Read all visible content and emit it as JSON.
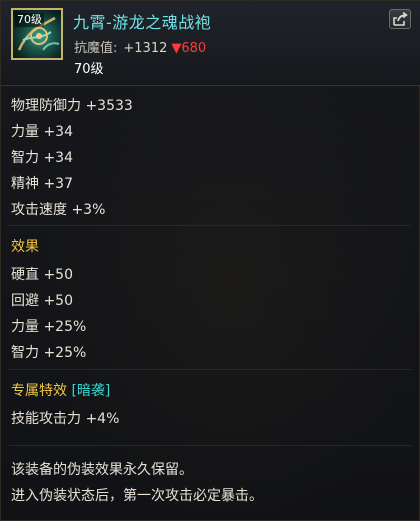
{
  "header": {
    "item_name": "九霄-游龙之魂战袍",
    "level_badge": "70级",
    "resist_label": "抗魔值:",
    "resist_value": "+1312",
    "resist_down": "▼680",
    "level_text": "70级",
    "icon": "armor-item-icon",
    "share_icon": "share-icon"
  },
  "stats": [
    "物理防御力 +3533",
    "力量 +34",
    "智力 +34",
    "精神 +37",
    "攻击速度 +3%"
  ],
  "effects": {
    "title": "效果",
    "lines": [
      "硬直 +50",
      "回避 +50",
      "力量 +25%",
      "智力 +25%"
    ]
  },
  "special": {
    "title": "专属特效",
    "tag": "[暗袭]",
    "lines": [
      "技能攻击力 +4%"
    ]
  },
  "notes": [
    "该装备的伪装效果永久保留。",
    "进入伪装状态后，第一次攻击必定暴击。"
  ],
  "colors": {
    "name": "#6fe3e4",
    "section": "#f0c640",
    "tag": "#36d6d0",
    "down": "#ff3b3b"
  }
}
